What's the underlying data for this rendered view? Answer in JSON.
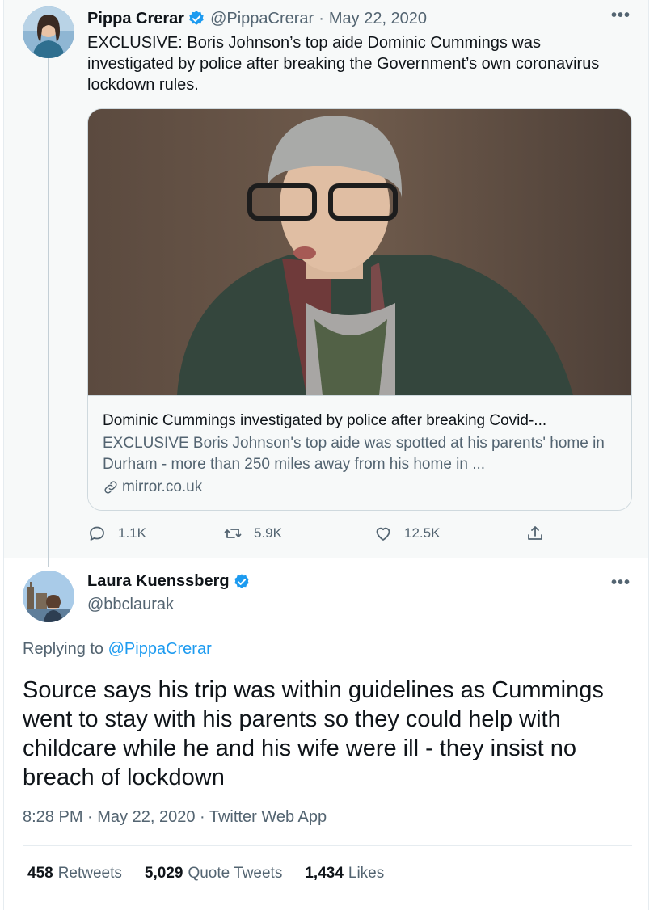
{
  "colors": {
    "accent": "#1d9bf0",
    "text_primary": "#0f1419",
    "text_secondary": "#536471",
    "border": "#cfd9de",
    "parent_bg": "#f7f9f9"
  },
  "parent_tweet": {
    "author_name": "Pippa Crerar",
    "verified": true,
    "handle": "@PippaCrerar",
    "separator": "·",
    "date": "May 22, 2020",
    "more_icon": "more-horizontal-icon",
    "text": "EXCLUSIVE: Boris Johnson’s top aide Dominic Cummings was investigated by police after breaking the Government’s own coronavirus lockdown rules.",
    "card": {
      "title": "Dominic Cummings investigated by police after breaking Covid-...",
      "description": "EXCLUSIVE Boris Johnson's top aide was spotted at his parents' home in Durham - more than 250 miles away from his home in ...",
      "domain": "mirror.co.uk",
      "link_icon": "link-icon"
    },
    "actions": {
      "replies": "1.1K",
      "retweets": "5.9K",
      "likes": "12.5K"
    }
  },
  "focal_tweet": {
    "author_name": "Laura Kuenssberg",
    "verified": true,
    "handle": "@bbclaurak",
    "more_icon": "more-horizontal-icon",
    "replying_prefix": "Replying to",
    "replying_to": "@PippaCrerar",
    "text": "Source says his trip was within guidelines as Cummings went to stay with his parents so they could help with childcare while he and his wife were ill - they insist no breach of lockdown",
    "meta": "8:28 PM · May 22, 2020 · Twitter Web App",
    "stats": [
      {
        "count": "458",
        "label": "Retweets"
      },
      {
        "count": "5,029",
        "label": "Quote Tweets"
      },
      {
        "count": "1,434",
        "label": "Likes"
      }
    ]
  }
}
